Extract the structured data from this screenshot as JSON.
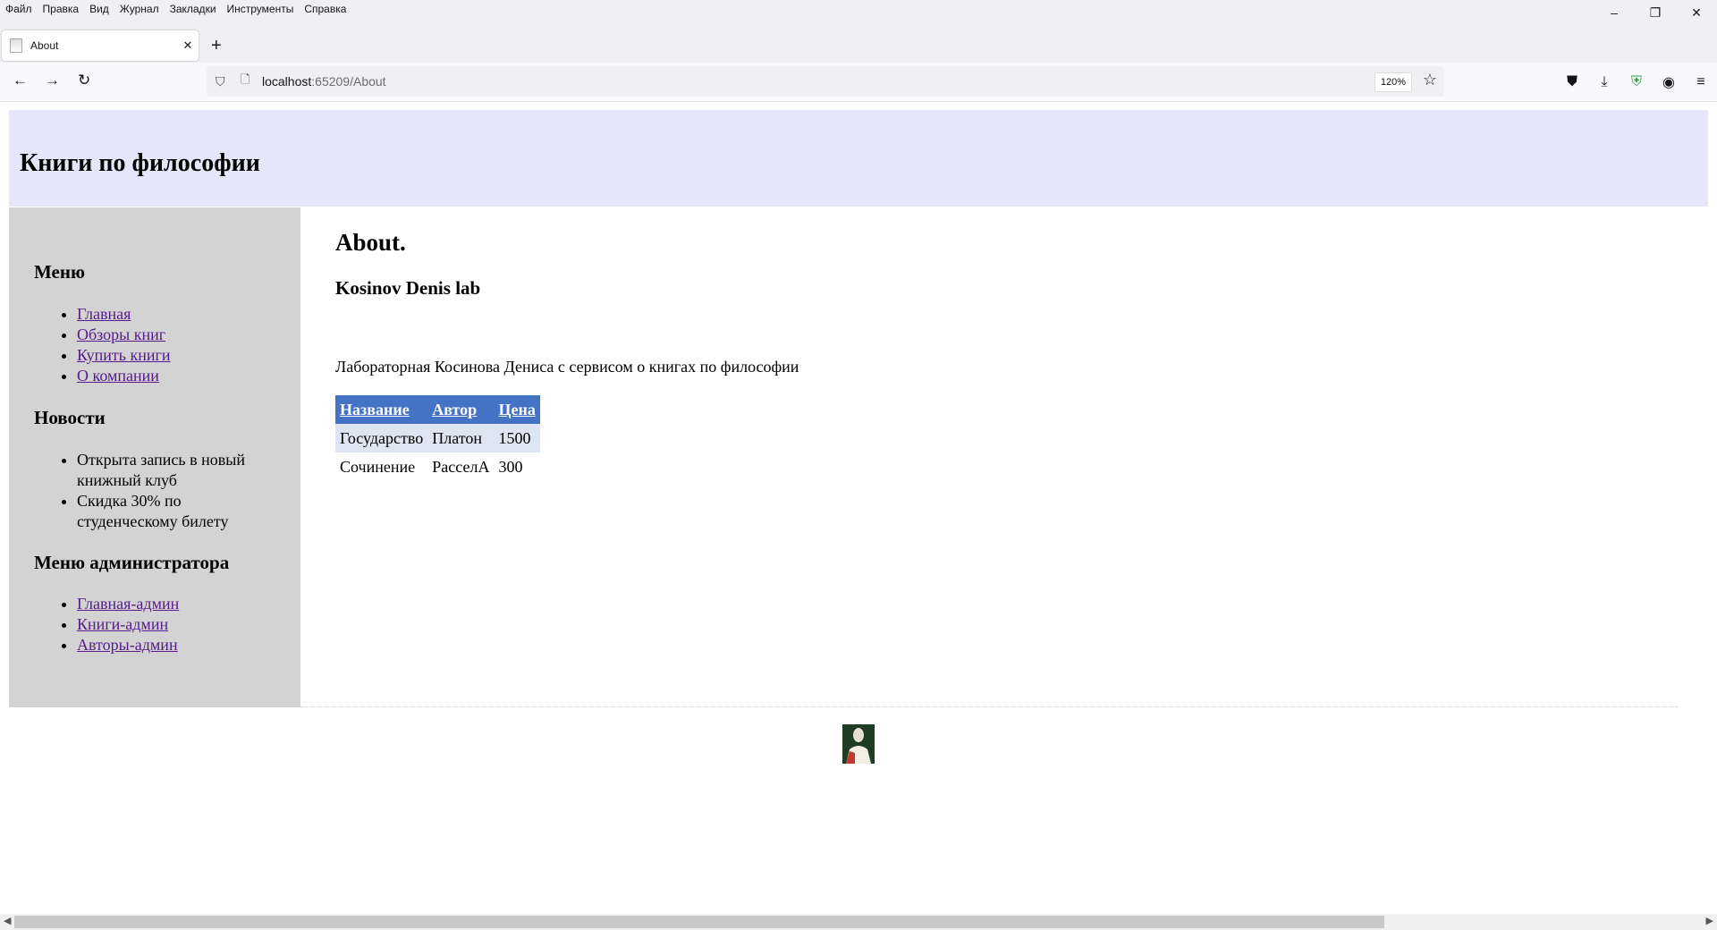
{
  "menubar": {
    "items": [
      "Файл",
      "Правка",
      "Вид",
      "Журнал",
      "Закладки",
      "Инструменты",
      "Справка"
    ]
  },
  "window_controls": {
    "minimize": "–",
    "restore": "❐",
    "close": "✕"
  },
  "tab": {
    "title": "About",
    "close": "✕"
  },
  "toolbar": {
    "new_tab": "+",
    "back": "←",
    "forward": "→",
    "reload": "↻",
    "url_host": "localhost",
    "url_path": ":65209/About",
    "zoom": "120%"
  },
  "site": {
    "header_title": "Книги по философии",
    "menu_heading": "Меню",
    "menu_links": [
      "Главная",
      "Обзоры книг",
      "Купить книги",
      "О компании"
    ],
    "news_heading": "Новости",
    "news_items": [
      "Открыта запись в новый книжный клуб",
      "Скидка 30% по студенческому билету"
    ],
    "admin_heading": "Меню администратора",
    "admin_links": [
      "Главная-админ",
      "Книги-админ",
      "Авторы-админ"
    ]
  },
  "content": {
    "title": "About.",
    "subtitle": "Kosinov Denis lab",
    "description": "Лабораторная Косинова Дениса с сервисом о книгах по философии",
    "table": {
      "headers": [
        "Название",
        "Автор",
        "Цена"
      ],
      "rows": [
        [
          "Государство",
          "Платон",
          "1500"
        ],
        [
          "Сочинение",
          "РасселА",
          "300"
        ]
      ]
    }
  },
  "colors": {
    "header_bg": "#e6e6fa",
    "sidebar_bg": "#d3d3d3",
    "table_header_bg": "#4472c4",
    "table_alt_row": "#dde4f2",
    "link": "#551a8b"
  }
}
